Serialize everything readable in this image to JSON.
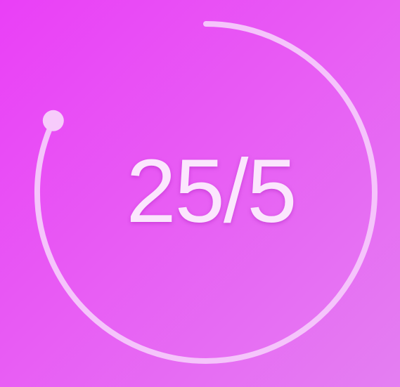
{
  "timer": {
    "readout": "25/5",
    "progress_fraction": 0.82,
    "ring_color": "#f5c4fb",
    "handle_color": "#f7cbfb"
  },
  "background": {
    "gradient_start": "#ea3ff7",
    "gradient_end": "#e47ff2"
  }
}
